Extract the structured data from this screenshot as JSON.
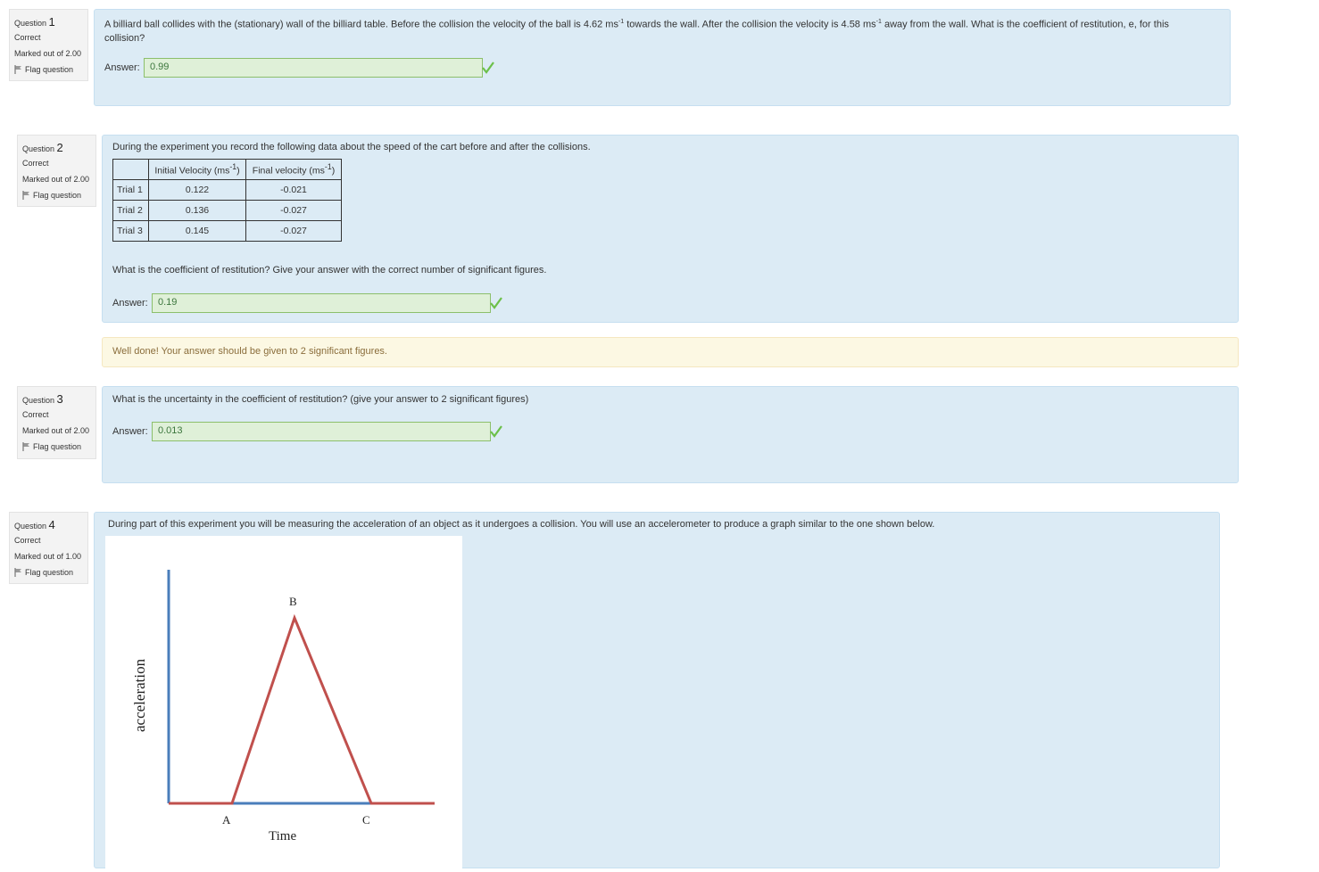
{
  "q1": {
    "info": {
      "label": "Question",
      "number": "1",
      "state": "Correct",
      "marks": "Marked out of 2.00",
      "flag": "Flag question"
    },
    "text_line1": "A billiard ball collides with the (stationary) wall of the billiard table. Before the collision the velocity of the ball is 4.62 ms",
    "text_sup1": "-1",
    "text_mid": " towards the wall. After the collision the velocity is 4.58 ms",
    "text_sup2": "-1",
    "text_end": " away from the wall. What is the coefficient of restitution, e, for this",
    "text_line2": "collision?",
    "answer_label": "Answer:",
    "answer_value": "0.99"
  },
  "q2": {
    "info": {
      "label": "Question",
      "number": "2",
      "state": "Correct",
      "marks": "Marked out of 2.00",
      "flag": "Flag question"
    },
    "intro": "During the experiment you record the following data about the speed of the cart before and after the collisions.",
    "table": {
      "headers": [
        "",
        "Initial Velocity (ms",
        "Final velocity (ms"
      ],
      "header_sup": "-1",
      "header_close": ")",
      "rows": [
        {
          "trial": "Trial 1",
          "initial": "0.122",
          "final": "-0.021"
        },
        {
          "trial": "Trial 2",
          "initial": "0.136",
          "final": "-0.027"
        },
        {
          "trial": "Trial 3",
          "initial": "0.145",
          "final": "-0.027"
        }
      ]
    },
    "question": "What is the coefficient of restitution? Give your answer with the correct number of significant figures.",
    "answer_label": "Answer:",
    "answer_value": "0.19",
    "feedback": "Well done! Your answer should be given to 2 significant figures."
  },
  "q3": {
    "info": {
      "label": "Question",
      "number": "3",
      "state": "Correct",
      "marks": "Marked out of 2.00",
      "flag": "Flag question"
    },
    "text": "What is the uncertainty in the coefficient of restitution? (give your answer to 2 significant figures)",
    "answer_label": "Answer:",
    "answer_value": "0.013"
  },
  "q4": {
    "info": {
      "label": "Question",
      "number": "4",
      "state": "Correct",
      "marks": "Marked out of 1.00",
      "flag": "Flag question"
    },
    "text": "During part of this experiment you will be measuring the acceleration of an object as it undergoes a collision. You will use an accelerometer to produce a graph similar to the one shown below.",
    "graph": {
      "ylabel": "acceleration",
      "xlabel": "Time",
      "point_labels": [
        "A",
        "B",
        "C"
      ],
      "colors": {
        "axes": "#4a7ebb",
        "curve": "#c0504d"
      }
    }
  }
}
